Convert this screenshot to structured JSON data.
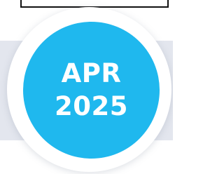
{
  "date_badge": {
    "month": "APR",
    "year": "2025"
  },
  "colors": {
    "badge_fill": "#1fb8ee",
    "band": "#e3e6ee",
    "ring": "#ffffff"
  }
}
